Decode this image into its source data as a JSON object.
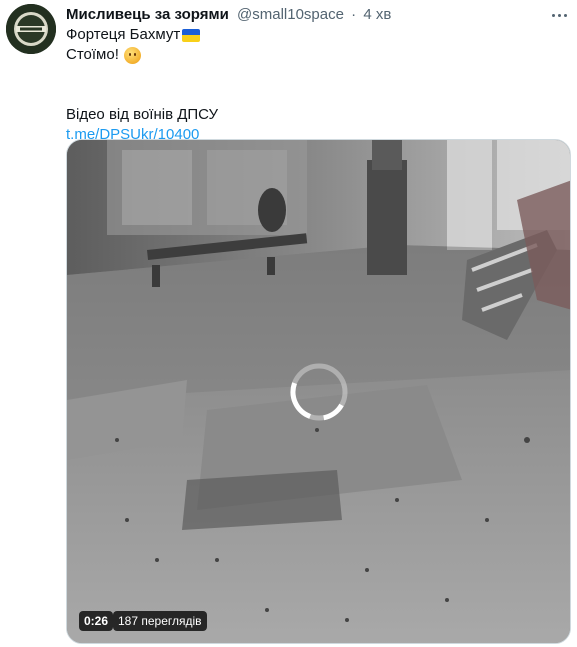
{
  "tweet": {
    "display_name": "Мисливець за зорями",
    "handle": "@small10space",
    "separator": "·",
    "time": "4 хв",
    "lines": {
      "line1": "Фортеця Бахмут",
      "line2": "Стоїмо!",
      "line3": "Відео від воїнів ДПСУ",
      "link": "t.me/DPSUkr/10400"
    },
    "icons": {
      "flag": "ukraine-flag-emoji",
      "emoji": "saluting-face-emoji",
      "more": "more-options-icon",
      "avatar": "avatar-image"
    }
  },
  "video": {
    "duration": "0:26",
    "views": "187 переглядів",
    "state": "loading-spinner"
  },
  "colors": {
    "link": "#1d9bf0",
    "secondary": "#536471",
    "badge_bg": "#000000",
    "flag_blue": "#1b5fd6",
    "flag_yellow": "#f8d019"
  }
}
